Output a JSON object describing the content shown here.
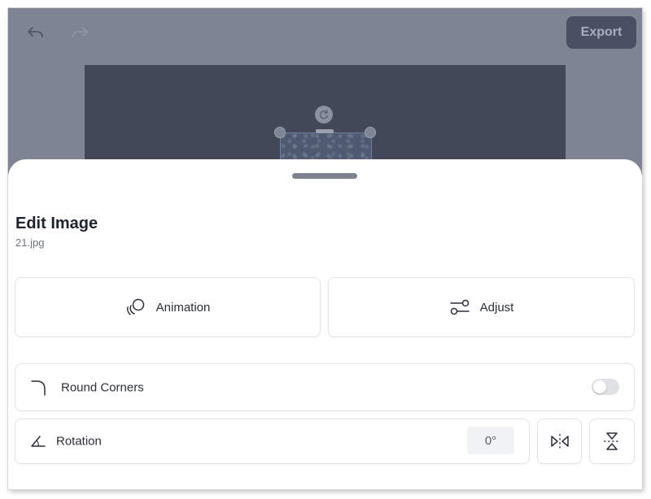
{
  "toolbar": {
    "export_label": "Export"
  },
  "sheet": {
    "title": "Edit Image",
    "filename": "21.jpg"
  },
  "actions": {
    "animation_label": "Animation",
    "adjust_label": "Adjust"
  },
  "round_corners": {
    "label": "Round Corners",
    "enabled": false
  },
  "rotation": {
    "label": "Rotation",
    "value": "0°"
  },
  "icons": [
    "undo-icon",
    "redo-icon",
    "rotate-handle-icon",
    "animation-icon",
    "adjust-icon",
    "round-corners-icon",
    "rotation-angle-icon",
    "flip-horizontal-icon",
    "flip-vertical-icon"
  ],
  "colors": {
    "canvas_bg": "#7e8494",
    "stage_bg": "#434859",
    "export_bg": "#4a5064",
    "sheet_bg": "#ffffff",
    "text": "#2a2f3a"
  }
}
